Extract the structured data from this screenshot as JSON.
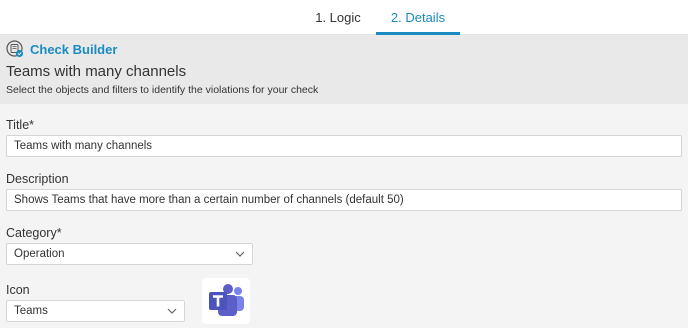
{
  "tabs": [
    {
      "label": "1. Logic",
      "active": false
    },
    {
      "label": "2. Details",
      "active": true
    }
  ],
  "header": {
    "builder_title": "Check Builder",
    "check_name": "Teams with many channels",
    "subtitle": "Select the objects and filters to identify the violations for your check",
    "icon": "check-builder-icon"
  },
  "form": {
    "title": {
      "label": "Title*",
      "value": "Teams with many channels"
    },
    "description": {
      "label": "Description",
      "value": "Shows Teams that have more than a certain number of channels (default 50)"
    },
    "category": {
      "label": "Category*",
      "value": "Operation"
    },
    "icon": {
      "label": "Icon",
      "value": "Teams",
      "preview": "microsoft-teams-icon"
    }
  },
  "colors": {
    "accent": "#1a8bc0",
    "header_bg": "#e9e9e9",
    "page_bg": "#f4f4f4",
    "teams_purple": "#5b5fc7"
  }
}
